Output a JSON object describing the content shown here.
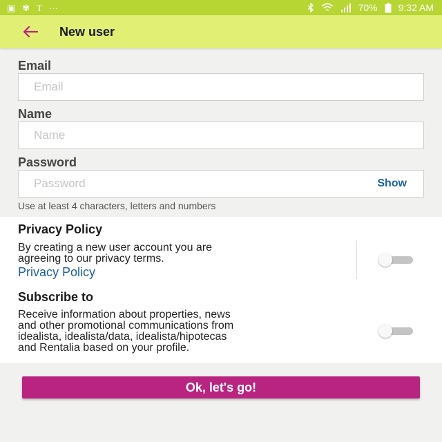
{
  "status_bar": {
    "left_icons": [
      "image-icon",
      "pinwheel-icon",
      "t-icon",
      "more-dots-icon"
    ],
    "left_glyphs": [
      "▣",
      "✾",
      "T",
      "···"
    ],
    "battery": "70%",
    "time": "9:32 AM"
  },
  "app_bar": {
    "title": "New user",
    "back_icon": "arrow-left-icon"
  },
  "form": {
    "email": {
      "label": "Email",
      "placeholder": "Email",
      "value": ""
    },
    "name": {
      "label": "Name",
      "placeholder": "Name",
      "value": ""
    },
    "password": {
      "label": "Password",
      "placeholder": "Password",
      "value": "",
      "show_label": "Show"
    },
    "hint": "Use at least 4 characters, letters and numbers"
  },
  "privacy": {
    "title": "Privacy Policy",
    "text_line1": "By creating a new user account you are",
    "text_line2": "agreeing to our privacy terms.",
    "link": "Privacy Policy",
    "toggle_on": false
  },
  "subscribe": {
    "title": "Subscribe to",
    "text_line1": "Receive information about properties, news",
    "text_line2": "and other promotional communications from",
    "text_line3": "idealista, idealista/data, idealista/hipotecas",
    "text_line4": "and Rentalia based on your profile.",
    "toggle_on": false
  },
  "submit_label": "Ok, let's go!",
  "colors": {
    "status_bar": "#b7d533",
    "app_bar": "#e1f074",
    "accent": "#b8247f",
    "link": "#1d5fa7"
  }
}
